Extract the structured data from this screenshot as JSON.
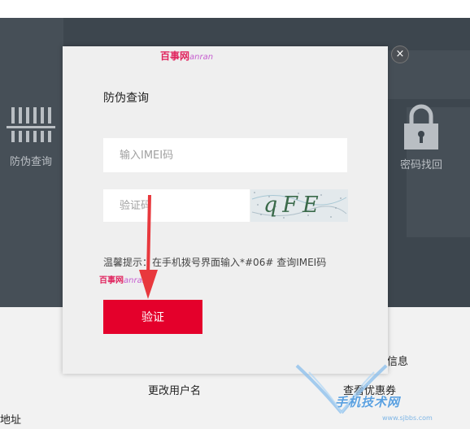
{
  "hero": {
    "left_label": "防伪查询",
    "right_label": "密码找回",
    "left_icon": "barcode-icon",
    "right_icon": "lock-icon"
  },
  "lower": {
    "item_info": "信息",
    "item_change_username": "更改用户名",
    "item_coupons": "查看优惠券",
    "item_address": "地址"
  },
  "modal": {
    "title": "防伪查询",
    "imei_placeholder": "输入IMEI码",
    "captcha_placeholder": "验证码",
    "captcha_text": "qFE",
    "hint": "温馨提示：在手机拨号界面输入*#06# 查询IMEI码",
    "verify_label": "验证",
    "close_label": "×"
  },
  "watermark": {
    "text": "百事网",
    "sub": "anran"
  },
  "corner_watermark": {
    "title": "手机技术网",
    "sub": "www.sjbbs.com"
  },
  "colors": {
    "accent": "#e4002b",
    "hero_bg": "#3d464e",
    "modal_bg": "#efefef"
  }
}
